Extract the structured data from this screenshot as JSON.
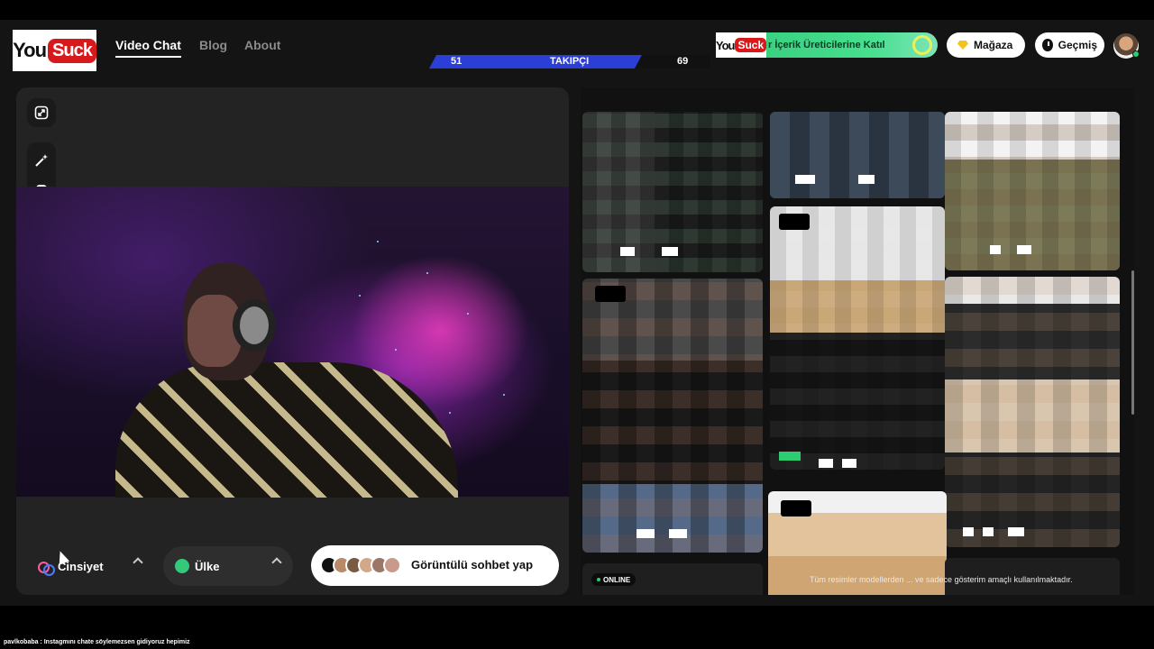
{
  "header": {
    "logo": {
      "you": "You",
      "suck": "Suck"
    },
    "nav": [
      {
        "label": "Video Chat",
        "active": true
      },
      {
        "label": "Blog",
        "active": false
      },
      {
        "label": "About",
        "active": false
      }
    ],
    "follow_bar": {
      "left_value": "51",
      "label": "TAKIPÇI",
      "right_value": "69"
    },
    "promo": {
      "logo_you": "You",
      "logo_suck": "Suck",
      "text": "r İçerik Üreticilerine Katıl"
    },
    "shop_button": {
      "label": "Mağaza",
      "icon": "gem-icon"
    },
    "history_button": {
      "label": "Geçmiş",
      "icon": "clock-icon"
    }
  },
  "left_panel": {
    "tools": [
      "expand-icon",
      "magic-wand-icon",
      "smile-icon"
    ],
    "gender_filter": {
      "label": "Cinsiyet",
      "icon": "gender-icon"
    },
    "country_filter": {
      "label": "Ülke",
      "icon": "globe-icon"
    },
    "start_button": {
      "label": "Görüntülü sohbet yap"
    }
  },
  "right_panel": {
    "online_badge": "ONLINE",
    "disclaimer": "Tüm resimler modellerden ... ve sadece gösterim amaçlı kullanılmaktadır."
  },
  "stream_overlay": {
    "chat_line": "pavlkobaba : Instagmını chate söylemezsen gidiyoruz hepimiz"
  },
  "colors": {
    "accent_blue": "#2b3ed6",
    "accent_green": "#34c97a",
    "brand_red": "#d8191c",
    "panel": "#232323",
    "background": "#141414"
  }
}
